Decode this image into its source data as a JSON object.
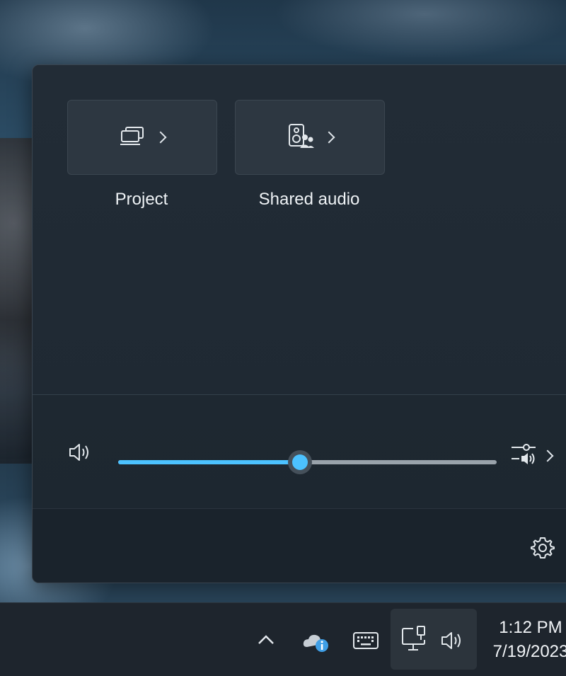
{
  "quick_settings": {
    "tiles": [
      {
        "label": "Project",
        "icon": "project-icon"
      },
      {
        "label": "Shared audio",
        "icon": "shared-audio-icon"
      }
    ],
    "volume": {
      "icon": "speaker-icon",
      "level_percent": 48,
      "mixer_icon": "audio-mixer-icon"
    },
    "footer": {
      "settings_icon": "gear-icon"
    }
  },
  "taskbar": {
    "overflow_icon": "chevron-up-icon",
    "onedrive_icon": "cloud-info-icon",
    "keyboard_icon": "keyboard-icon",
    "network_icon": "wired-network-icon",
    "volume_icon": "speaker-icon",
    "clock": {
      "time": "1:12 PM",
      "date": "7/19/2023"
    }
  },
  "colors": {
    "accent": "#4cc2ff",
    "panel_bg": "#202a34",
    "taskbar_bg": "#1e252d"
  }
}
